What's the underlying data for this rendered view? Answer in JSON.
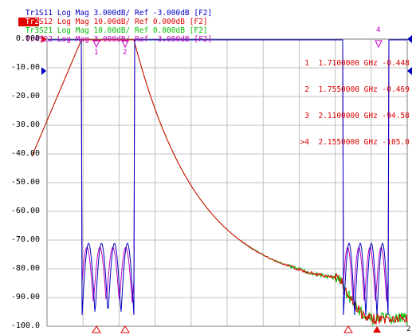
{
  "traces": [
    {
      "id": "Tr1",
      "text": "S11 Log Mag 3.000dB/ Ref -3.000dB [F2]",
      "color": "#0000c0",
      "active": false
    },
    {
      "id": "Tr2",
      "text": "S12 Log Mag 10.00dB/ Ref 0.000dB [F2]",
      "color": "#e00000",
      "active": true
    },
    {
      "id": "Tr3",
      "text": "S21 Log Mag 10.00dB/ Ref 0.000dB [F2]",
      "color": "#00c000",
      "active": false
    },
    {
      "id": "Tr4",
      "text": "S22 Log Mag 3.000dB/ Ref -3.000dB [F2]",
      "color": "#c000c0",
      "active": false
    }
  ],
  "y_axis_labels": [
    "0.000",
    "-10.00",
    "-20.00",
    "-30.00",
    "-40.00",
    "-50.00",
    "-60.00",
    "-70.00",
    "-80.00",
    "-90.00",
    "-100.0"
  ],
  "markers": [
    {
      "num": "1",
      "freq": "1.7100000 GHz",
      "value": "-0.448"
    },
    {
      "num": "2",
      "freq": "1.7550000 GHz",
      "value": "-0.469"
    },
    {
      "num": "3",
      "freq": "2.1100000 GHz",
      "value": "-94.58"
    },
    {
      "num": ">4",
      "freq": "2.1550000 GHz",
      "value": "-105.0"
    }
  ],
  "marker_flags": [
    "1",
    "2",
    "4"
  ],
  "x_end_label": "2",
  "colors": {
    "s11": "#0000c0",
    "s12": "#e00000",
    "s21": "#00c000",
    "s22": "#c000c0",
    "grid": "#c0c0c0"
  }
}
